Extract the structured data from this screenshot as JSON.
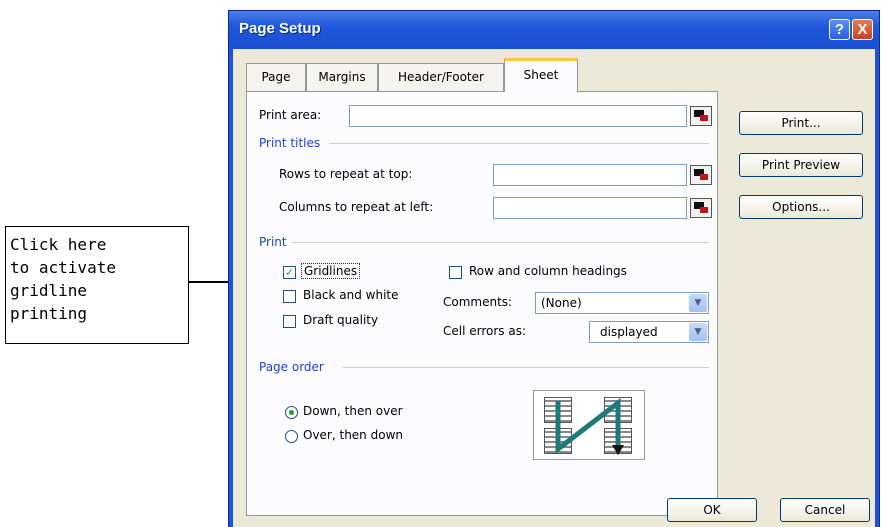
{
  "callout": {
    "lines": [
      "Click here",
      "to activate",
      "gridline",
      "printing"
    ]
  },
  "window": {
    "title": "Page Setup",
    "help_glyph": "?",
    "close_glyph": "X"
  },
  "tabs": [
    {
      "label": "Page"
    },
    {
      "label": "Margins"
    },
    {
      "label": "Header/Footer"
    },
    {
      "label": "Sheet"
    }
  ],
  "active_tab": "Sheet",
  "print_area": {
    "label": "Print area:",
    "value": ""
  },
  "print_titles": {
    "heading": "Print titles",
    "rows_label": "Rows to repeat at top:",
    "rows_value": "",
    "cols_label": "Columns to repeat at left:",
    "cols_value": ""
  },
  "print": {
    "heading": "Print",
    "gridlines": {
      "label": "Gridlines",
      "checked": true
    },
    "black_white": {
      "label": "Black and white",
      "checked": false
    },
    "draft": {
      "label": "Draft quality",
      "checked": false
    },
    "row_col_headings": {
      "label": "Row and column headings",
      "checked": false
    },
    "comments": {
      "label": "Comments:",
      "value": "(None)"
    },
    "cell_errors": {
      "label": "Cell errors as:",
      "value": "displayed"
    }
  },
  "page_order": {
    "heading": "Page order",
    "down_then_over": {
      "label": "Down, then over",
      "selected": true
    },
    "over_then_down": {
      "label": "Over, then down",
      "selected": false
    }
  },
  "buttons": {
    "print": "Print...",
    "print_preview": "Print Preview",
    "options": "Options...",
    "ok": "OK",
    "cancel": "Cancel"
  },
  "colors": {
    "accent": "#1f52d8",
    "group_heading": "#1a46c8",
    "check": "#21a121"
  }
}
